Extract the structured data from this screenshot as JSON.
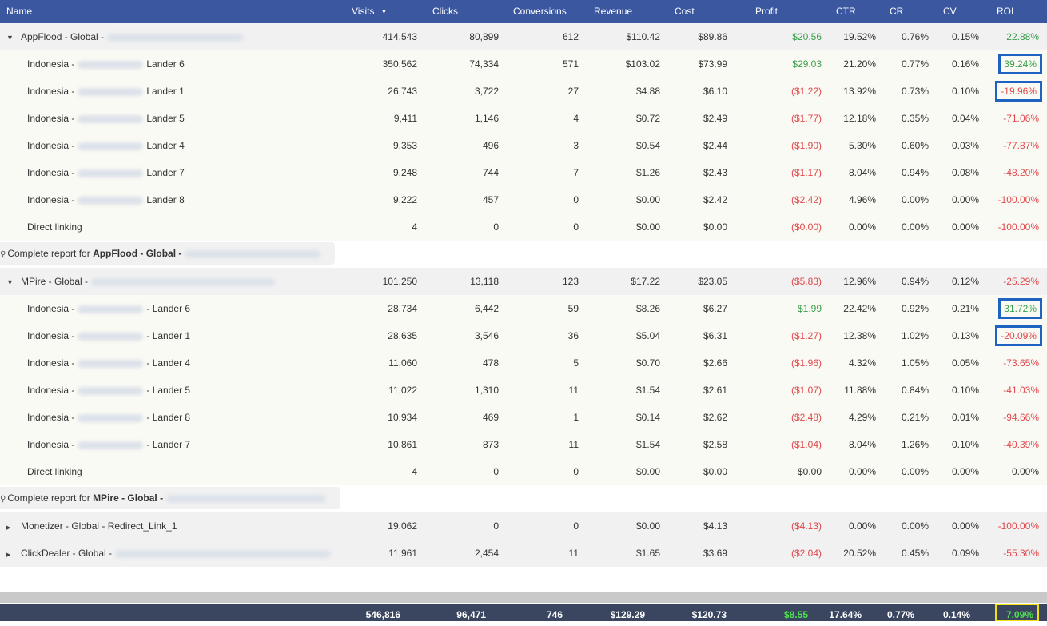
{
  "columns": {
    "name": "Name",
    "visits": "Visits",
    "clicks": "Clicks",
    "conversions": "Conversions",
    "revenue": "Revenue",
    "cost": "Cost",
    "profit": "Profit",
    "ctr": "CTR",
    "cr": "CR",
    "cv": "CV",
    "roi": "ROI"
  },
  "groups": [
    {
      "name": "AppFlood - Global -",
      "visits": "414,543",
      "clicks": "80,899",
      "conversions": "612",
      "revenue": "$110.42",
      "cost": "$89.86",
      "profit": "$20.56",
      "ctr": "19.52%",
      "cr": "0.76%",
      "cv": "0.15%",
      "roi": "22.88%",
      "rows": [
        {
          "prefix": "Indonesia -",
          "suffix": "Lander 6",
          "visits": "350,562",
          "clicks": "74,334",
          "conversions": "571",
          "revenue": "$103.02",
          "cost": "$73.99",
          "profit": "$29.03",
          "ctr": "21.20%",
          "cr": "0.77%",
          "cv": "0.16%",
          "roi": "39.24%"
        },
        {
          "prefix": "Indonesia -",
          "suffix": "Lander 1",
          "visits": "26,743",
          "clicks": "3,722",
          "conversions": "27",
          "revenue": "$4.88",
          "cost": "$6.10",
          "profit": "($1.22)",
          "ctr": "13.92%",
          "cr": "0.73%",
          "cv": "0.10%",
          "roi": "-19.96%"
        },
        {
          "prefix": "Indonesia -",
          "suffix": "Lander 5",
          "visits": "9,411",
          "clicks": "1,146",
          "conversions": "4",
          "revenue": "$0.72",
          "cost": "$2.49",
          "profit": "($1.77)",
          "ctr": "12.18%",
          "cr": "0.35%",
          "cv": "0.04%",
          "roi": "-71.06%"
        },
        {
          "prefix": "Indonesia -",
          "suffix": "Lander 4",
          "visits": "9,353",
          "clicks": "496",
          "conversions": "3",
          "revenue": "$0.54",
          "cost": "$2.44",
          "profit": "($1.90)",
          "ctr": "5.30%",
          "cr": "0.60%",
          "cv": "0.03%",
          "roi": "-77.87%"
        },
        {
          "prefix": "Indonesia -",
          "suffix": "Lander 7",
          "visits": "9,248",
          "clicks": "744",
          "conversions": "7",
          "revenue": "$1.26",
          "cost": "$2.43",
          "profit": "($1.17)",
          "ctr": "8.04%",
          "cr": "0.94%",
          "cv": "0.08%",
          "roi": "-48.20%"
        },
        {
          "prefix": "Indonesia -",
          "suffix": "Lander 8",
          "visits": "9,222",
          "clicks": "457",
          "conversions": "0",
          "revenue": "$0.00",
          "cost": "$2.42",
          "profit": "($2.42)",
          "ctr": "4.96%",
          "cr": "0.00%",
          "cv": "0.00%",
          "roi": "-100.00%"
        },
        {
          "prefix": "Direct linking",
          "suffix": "",
          "visits": "4",
          "clicks": "0",
          "conversions": "0",
          "revenue": "$0.00",
          "cost": "$0.00",
          "profit": "($0.00)",
          "ctr": "0.00%",
          "cr": "0.00%",
          "cv": "0.00%",
          "roi": "-100.00%"
        }
      ],
      "report": {
        "prefix": "Complete report for",
        "name": "AppFlood - Global -"
      }
    },
    {
      "name": "MPire - Global -",
      "visits": "101,250",
      "clicks": "13,118",
      "conversions": "123",
      "revenue": "$17.22",
      "cost": "$23.05",
      "profit": "($5.83)",
      "ctr": "12.96%",
      "cr": "0.94%",
      "cv": "0.12%",
      "roi": "-25.29%",
      "rows": [
        {
          "prefix": "Indonesia -",
          "suffix": "- Lander 6",
          "visits": "28,734",
          "clicks": "6,442",
          "conversions": "59",
          "revenue": "$8.26",
          "cost": "$6.27",
          "profit": "$1.99",
          "ctr": "22.42%",
          "cr": "0.92%",
          "cv": "0.21%",
          "roi": "31.72%"
        },
        {
          "prefix": "Indonesia -",
          "suffix": "- Lander 1",
          "visits": "28,635",
          "clicks": "3,546",
          "conversions": "36",
          "revenue": "$5.04",
          "cost": "$6.31",
          "profit": "($1.27)",
          "ctr": "12.38%",
          "cr": "1.02%",
          "cv": "0.13%",
          "roi": "-20.09%"
        },
        {
          "prefix": "Indonesia -",
          "suffix": "- Lander 4",
          "visits": "11,060",
          "clicks": "478",
          "conversions": "5",
          "revenue": "$0.70",
          "cost": "$2.66",
          "profit": "($1.96)",
          "ctr": "4.32%",
          "cr": "1.05%",
          "cv": "0.05%",
          "roi": "-73.65%"
        },
        {
          "prefix": "Indonesia -",
          "suffix": "- Lander 5",
          "visits": "11,022",
          "clicks": "1,310",
          "conversions": "11",
          "revenue": "$1.54",
          "cost": "$2.61",
          "profit": "($1.07)",
          "ctr": "11.88%",
          "cr": "0.84%",
          "cv": "0.10%",
          "roi": "-41.03%"
        },
        {
          "prefix": "Indonesia -",
          "suffix": "- Lander 8",
          "visits": "10,934",
          "clicks": "469",
          "conversions": "1",
          "revenue": "$0.14",
          "cost": "$2.62",
          "profit": "($2.48)",
          "ctr": "4.29%",
          "cr": "0.21%",
          "cv": "0.01%",
          "roi": "-94.66%"
        },
        {
          "prefix": "Indonesia -",
          "suffix": "- Lander 7",
          "visits": "10,861",
          "clicks": "873",
          "conversions": "11",
          "revenue": "$1.54",
          "cost": "$2.58",
          "profit": "($1.04)",
          "ctr": "8.04%",
          "cr": "1.26%",
          "cv": "0.10%",
          "roi": "-40.39%"
        },
        {
          "prefix": "Direct linking",
          "suffix": "",
          "visits": "4",
          "clicks": "0",
          "conversions": "0",
          "revenue": "$0.00",
          "cost": "$0.00",
          "profit": "$0.00",
          "ctr": "0.00%",
          "cr": "0.00%",
          "cv": "0.00%",
          "roi": "0.00%"
        }
      ],
      "report": {
        "prefix": "Complete report for",
        "name": "MPire - Global -"
      }
    }
  ],
  "collapsed": [
    {
      "name": "Monetizer - Global - Redirect_Link_1",
      "visits": "19,062",
      "clicks": "0",
      "conversions": "0",
      "revenue": "$0.00",
      "cost": "$4.13",
      "profit": "($4.13)",
      "ctr": "0.00%",
      "cr": "0.00%",
      "cv": "0.00%",
      "roi": "-100.00%"
    },
    {
      "name": "ClickDealer - Global -",
      "visits": "11,961",
      "clicks": "2,454",
      "conversions": "11",
      "revenue": "$1.65",
      "cost": "$3.69",
      "profit": "($2.04)",
      "ctr": "20.52%",
      "cr": "0.45%",
      "cv": "0.09%",
      "roi": "-55.30%"
    }
  ],
  "totals": {
    "visits": "546,816",
    "clicks": "96,471",
    "conversions": "746",
    "revenue": "$129.29",
    "cost": "$120.73",
    "profit": "$8.55",
    "ctr": "17.64%",
    "cr": "0.77%",
    "cv": "0.14%",
    "roi": "7.09%"
  },
  "colors": {
    "header": "#3b57a0",
    "positive": "#3aa04a",
    "negative": "#e0494d",
    "highlight": "#1e63c2",
    "footer_highlight": "#f0e010"
  },
  "icons": {
    "sort": "sort-desc-icon",
    "expand": "caret-down-icon",
    "collapse": "caret-right-icon",
    "report": "magnifier-icon"
  }
}
